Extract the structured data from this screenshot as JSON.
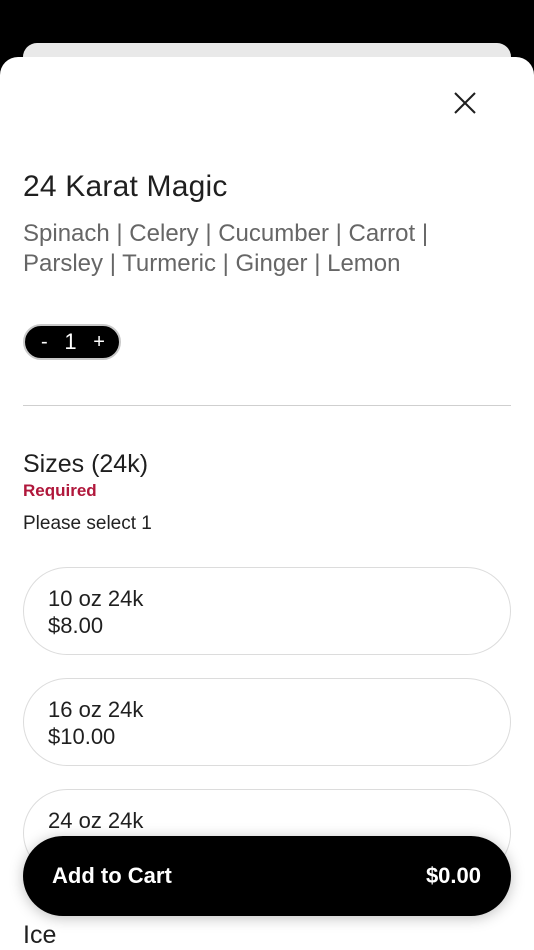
{
  "product": {
    "title": "24 Karat Magic",
    "description": "Spinach | Celery | Cucumber | Carrot | Parsley | Turmeric | Ginger | Lemon"
  },
  "quantity": {
    "decrement_label": "-",
    "value": "1",
    "increment_label": "+"
  },
  "sizes": {
    "title": "Sizes (24k)",
    "required_label": "Required",
    "instruction": "Please select 1",
    "options": [
      {
        "name": "10 oz 24k",
        "price": "$8.00"
      },
      {
        "name": "16 oz 24k",
        "price": "$10.00"
      },
      {
        "name": "24 oz 24k",
        "price": ""
      }
    ]
  },
  "next_section": {
    "title": "Ice"
  },
  "cart": {
    "button_label": "Add to Cart",
    "total": "$0.00"
  },
  "icons": {
    "close": "close-icon"
  },
  "colors": {
    "required": "#b0173b",
    "primary_button": "#000000"
  }
}
